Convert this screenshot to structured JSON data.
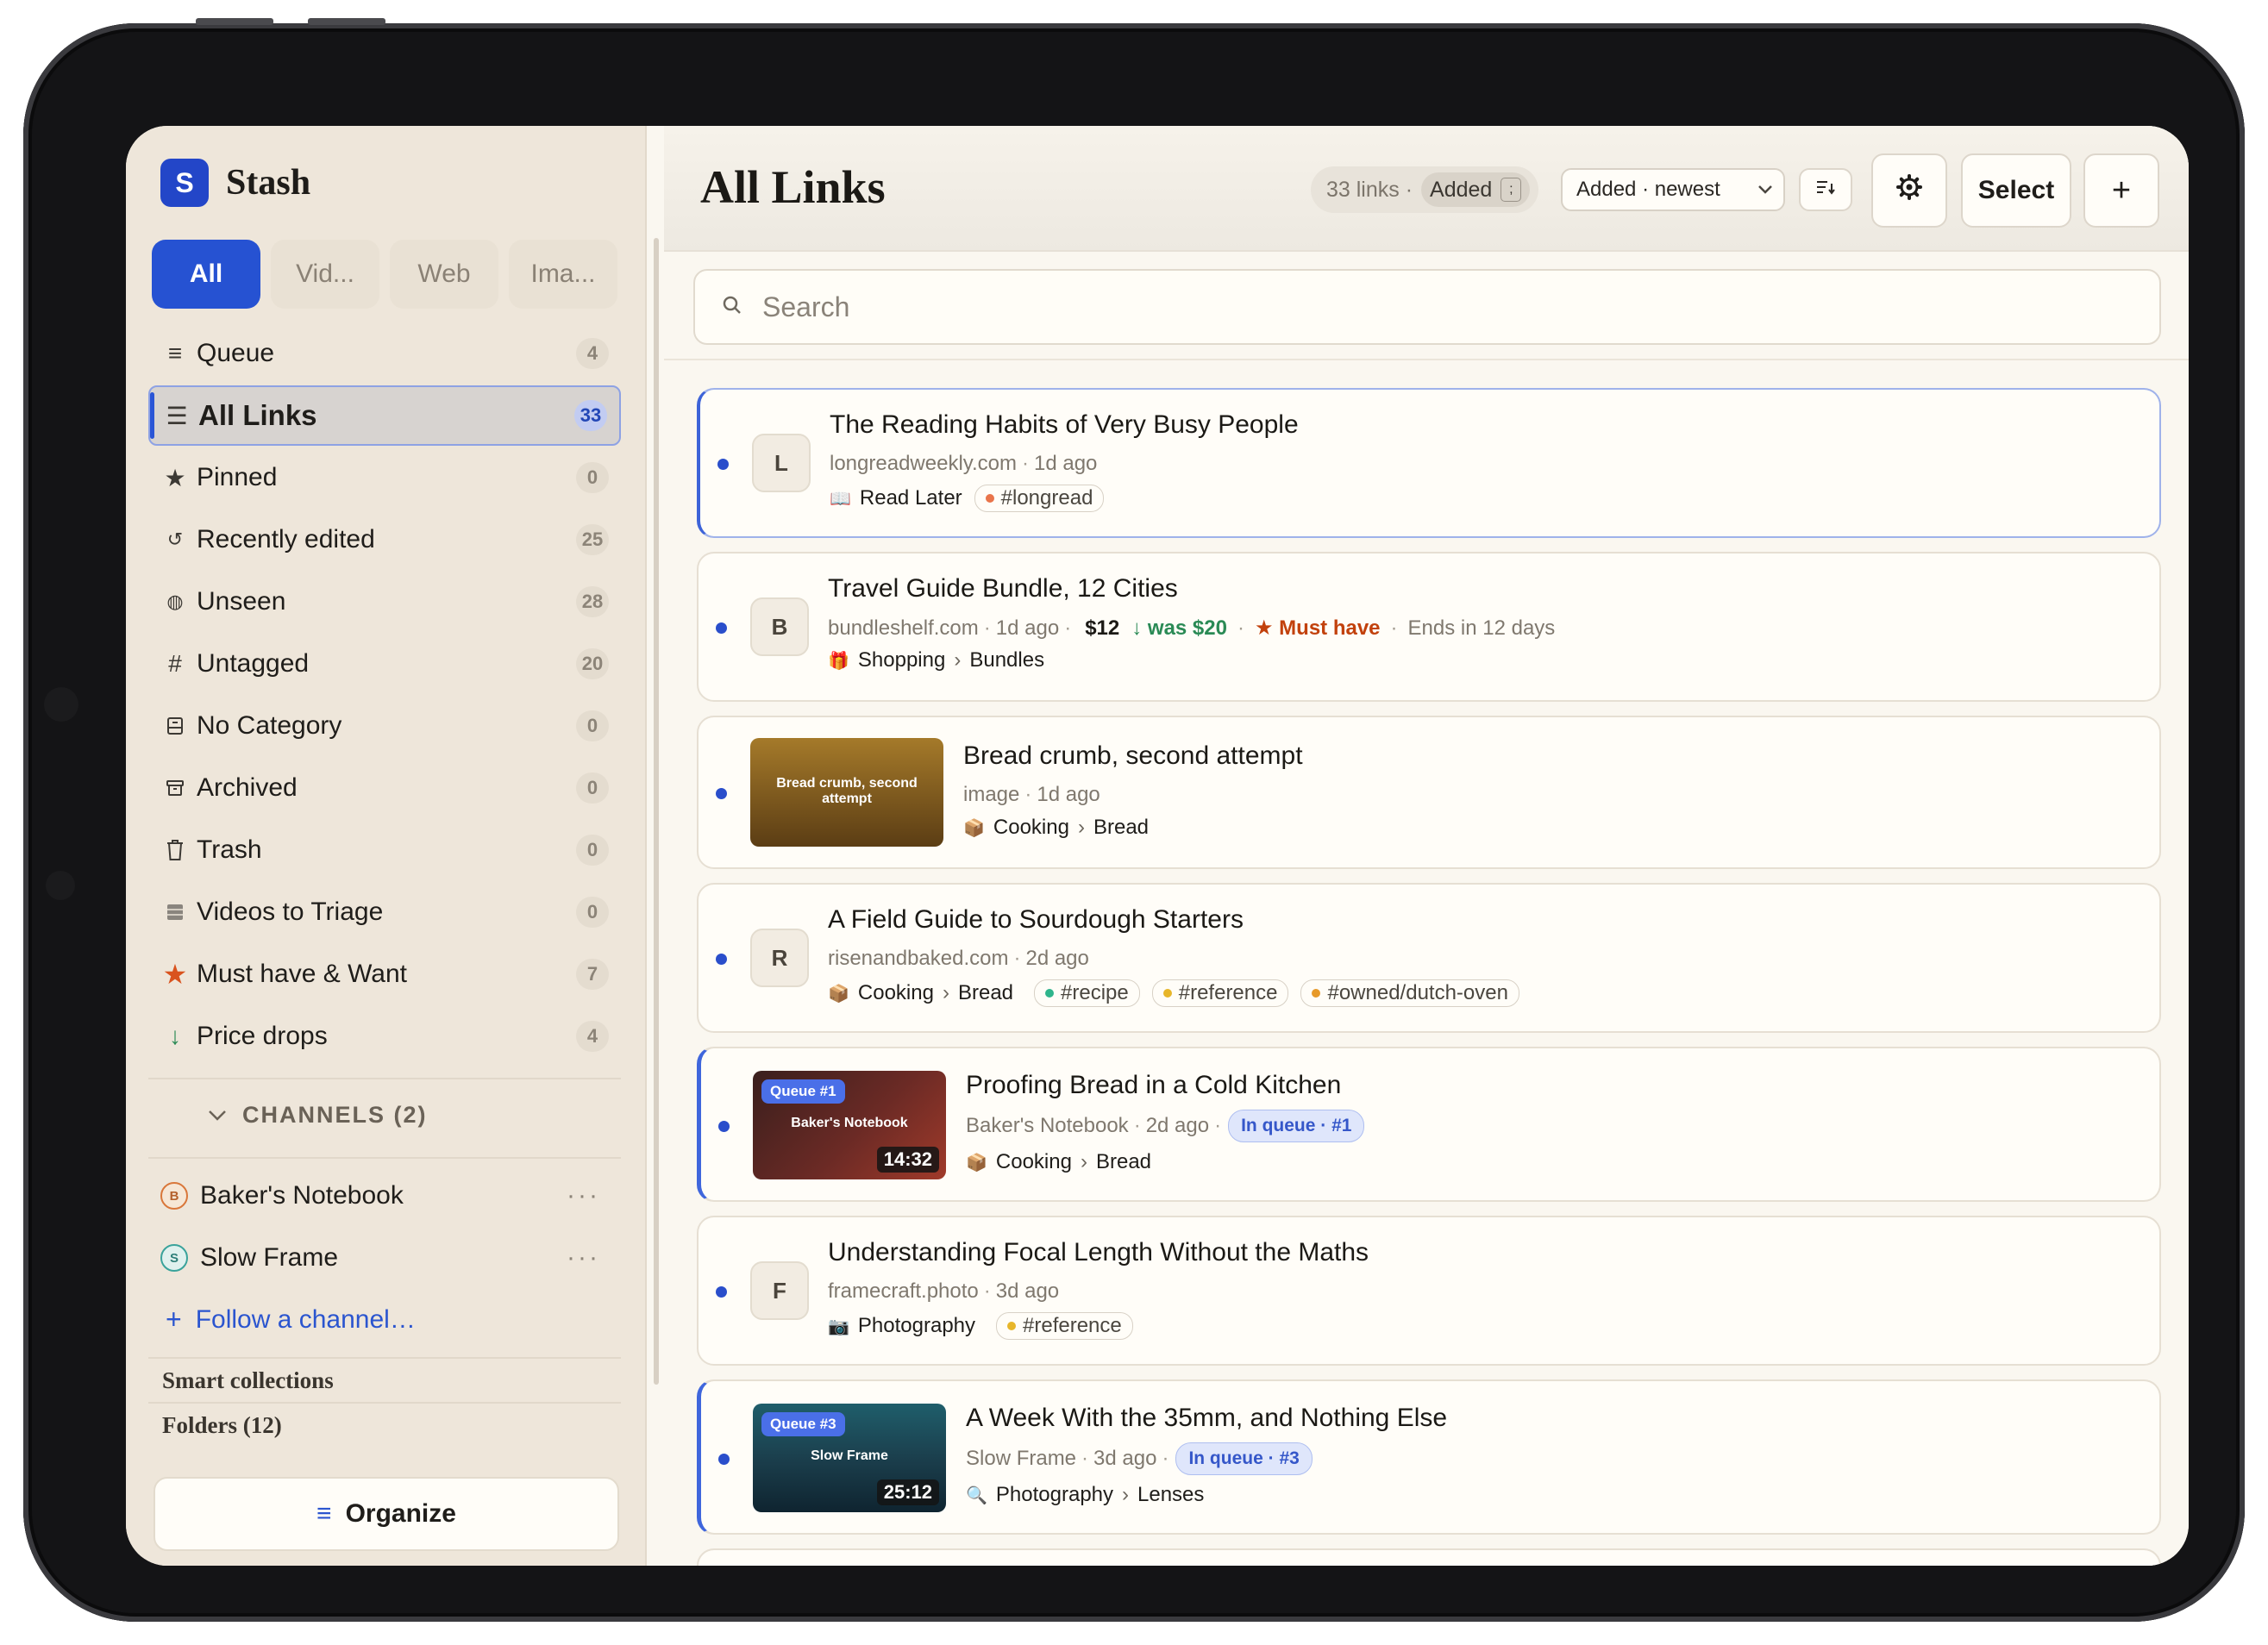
{
  "app": {
    "name": "Stash",
    "logo_letter": "S"
  },
  "filter_tabs": [
    "All",
    "Vid...",
    "Web",
    "Ima..."
  ],
  "nav": [
    {
      "label": "Queue",
      "count": "4",
      "icon": "list-icon"
    },
    {
      "label": "All Links",
      "count": "33",
      "icon": "lines-icon",
      "active": true
    },
    {
      "label": "Pinned",
      "count": "0",
      "icon": "star-icon"
    },
    {
      "label": "Recently edited",
      "count": "25",
      "icon": "refresh-icon"
    },
    {
      "label": "Unseen",
      "count": "28",
      "icon": "eye-icon"
    },
    {
      "label": "Untagged",
      "count": "20",
      "icon": "hash-icon"
    },
    {
      "label": "No Category",
      "count": "0",
      "icon": "tray-icon"
    },
    {
      "label": "Archived",
      "count": "0",
      "icon": "archive-icon"
    },
    {
      "label": "Trash",
      "count": "0",
      "icon": "trash-icon"
    },
    {
      "label": "Videos to Triage",
      "count": "0",
      "icon": "film-icon"
    },
    {
      "label": "Must have & Want",
      "count": "7",
      "icon": "star-filled-icon"
    },
    {
      "label": "Price drops",
      "count": "4",
      "icon": "arrow-down-icon"
    }
  ],
  "channels": {
    "heading": "CHANNELS (2)",
    "items": [
      {
        "name": "Baker's Notebook",
        "initial": "B",
        "color": "#d9773a"
      },
      {
        "name": "Slow Frame",
        "initial": "S",
        "color": "#3aa39b"
      }
    ],
    "follow_label": "Follow a channel…"
  },
  "smart_collections_label": "Smart collections",
  "folders_label": "Folders (12)",
  "organize_label": "Organize",
  "header": {
    "title": "All Links",
    "count_text": "33 links ·",
    "sort_badge": "Added",
    "kbd": ";",
    "sort_select": "Added · newest",
    "select_label": "Select",
    "add_label": "+"
  },
  "search": {
    "placeholder": "Search"
  },
  "links": [
    {
      "title": "The Reading Habits of Very Busy People",
      "initial": "L",
      "source": "longreadweekly.com",
      "age": "1d ago",
      "category_icon": "📖",
      "category": "Read Later",
      "tags": [
        {
          "label": "#longread",
          "color": "#e9744a"
        }
      ]
    },
    {
      "title": "Travel Guide Bundle, 12 Cities",
      "initial": "B",
      "source": "bundleshelf.com",
      "age": "1d ago",
      "price": "$12",
      "was": "↓ was $20",
      "priority": "★ Must have",
      "ends": "Ends in 12 days",
      "category_icon": "🎁",
      "category": "Shopping",
      "subcategory": "Bundles"
    },
    {
      "title": "Bread crumb, second attempt",
      "thumb_text": "Bread crumb, second attempt",
      "source": "image",
      "age": "1d ago",
      "category_icon": "📦",
      "category": "Cooking",
      "subcategory": "Bread"
    },
    {
      "title": "A Field Guide to Sourdough Starters",
      "initial": "R",
      "source": "risenandbaked.com",
      "age": "2d ago",
      "category_icon": "📦",
      "category": "Cooking",
      "subcategory": "Bread",
      "tags": [
        {
          "label": "#recipe",
          "color": "#2fb58c"
        },
        {
          "label": "#reference",
          "color": "#e7b62a"
        },
        {
          "label": "#owned/dutch-oven",
          "color": "#e79a2a"
        }
      ]
    },
    {
      "title": "Proofing Bread in a Cold Kitchen",
      "thumb_text": "Baker's Notebook",
      "queue_badge": "Queue #1",
      "duration": "14:32",
      "source": "Baker's Notebook",
      "age": "2d ago",
      "queue_pill": "In queue · #1",
      "category_icon": "📦",
      "category": "Cooking",
      "subcategory": "Bread"
    },
    {
      "title": "Understanding Focal Length Without the Maths",
      "initial": "F",
      "source": "framecraft.photo",
      "age": "3d ago",
      "category_icon": "📷",
      "category": "Photography",
      "tags": [
        {
          "label": "#reference",
          "color": "#e7b62a"
        }
      ]
    },
    {
      "title": "A Week With the 35mm, and Nothing Else",
      "thumb_text": "Slow Frame",
      "queue_badge": "Queue #3",
      "duration": "25:12",
      "source": "Slow Frame",
      "age": "3d ago",
      "queue_pill": "In queue · #3",
      "category_icon": "🔍",
      "category": "Photography",
      "subcategory": "Lenses"
    }
  ]
}
